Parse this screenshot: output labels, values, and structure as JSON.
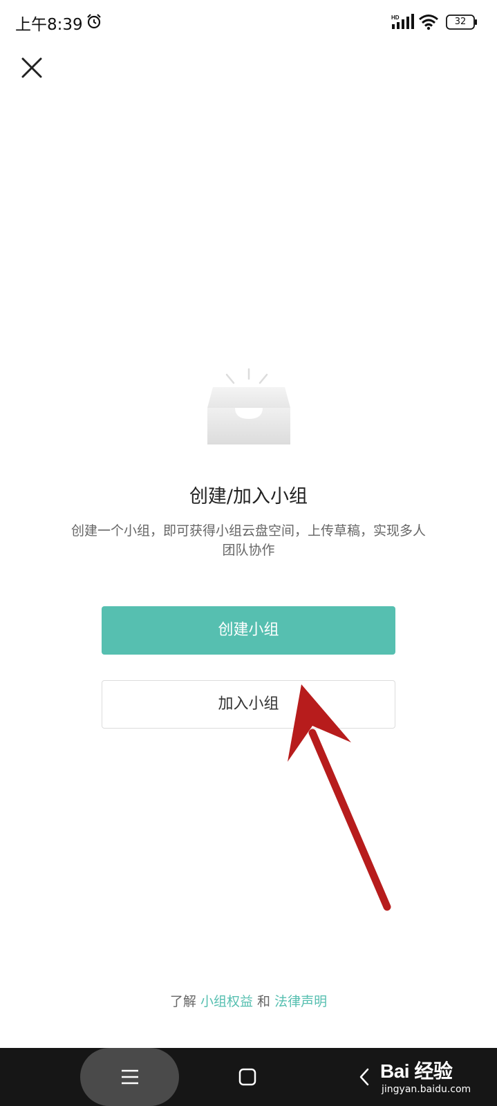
{
  "status_bar": {
    "time": "上午8:39",
    "network_label": "HD",
    "battery": "32"
  },
  "empty_state": {
    "title": "创建/加入小组",
    "description": "创建一个小组，即可获得小组云盘空间，上传草稿，实现多人团队协作"
  },
  "buttons": {
    "create": "创建小组",
    "join": "加入小组"
  },
  "footer": {
    "prefix": "了解",
    "link_benefits": "小组权益",
    "conjunction": "和",
    "link_legal": "法律声明"
  },
  "watermark": {
    "brand": "Bai 经验",
    "url": "jingyan.baidu.com"
  },
  "colors": {
    "accent": "#56bfb0",
    "annotation_arrow": "#b71c1c"
  }
}
